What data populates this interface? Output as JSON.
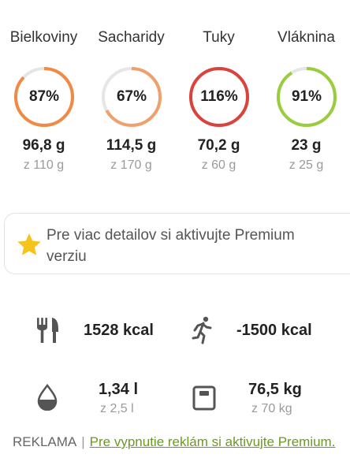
{
  "macros": [
    {
      "name": "Bielkoviny",
      "percent": "87%",
      "amount": "96,8 g",
      "goal": "z 110 g",
      "progress": 0.87,
      "color": "#f08a45"
    },
    {
      "name": "Sacharidy",
      "percent": "67%",
      "amount": "114,5 g",
      "goal": "z 170 g",
      "progress": 0.67,
      "color": "#f0a06a"
    },
    {
      "name": "Tuky",
      "percent": "116%",
      "amount": "70,2 g",
      "goal": "z 60 g",
      "progress": 1.16,
      "color": "#d9433b"
    },
    {
      "name": "Vláknina",
      "percent": "91%",
      "amount": "23 g",
      "goal": "z 25 g",
      "progress": 0.91,
      "color": "#9acd3e"
    }
  ],
  "premium": {
    "message": "Pre viac detailov si aktivujte Premium verziu",
    "icon": "star-icon",
    "icon_color": "#f6c31c"
  },
  "stats": {
    "food": {
      "value": "1528 kcal",
      "icon": "fork-knife-icon"
    },
    "activity": {
      "value": "-1500 kcal",
      "icon": "running-icon"
    },
    "water": {
      "value": "1,34 l",
      "goal": "z 2,5 l",
      "icon": "water-drop-icon"
    },
    "weight": {
      "value": "76,5 kg",
      "goal": "z 70 kg",
      "icon": "scale-icon"
    }
  },
  "ad": {
    "label": "REKLAMA",
    "separator": "|",
    "link": "Pre vypnutie reklám si aktivujte Premium."
  },
  "colors": {
    "track": "#e6e6e6",
    "icon": "#555555",
    "link": "#6a9a1f"
  }
}
